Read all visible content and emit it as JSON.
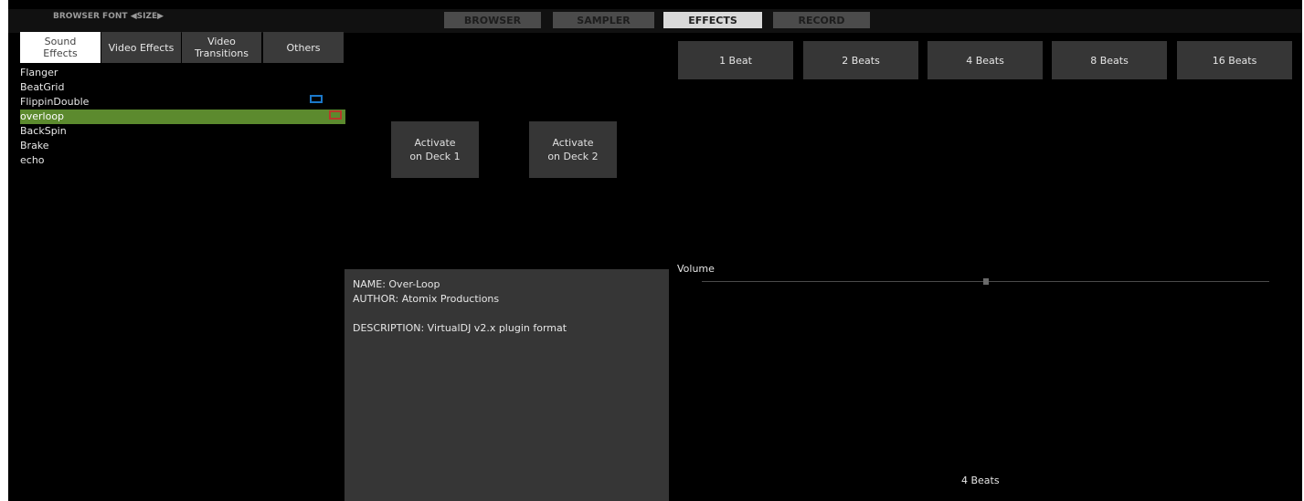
{
  "header": {
    "browser_font": "BROWSER FONT",
    "size": "SIZE",
    "left_arrow": "◀",
    "right_arrow": "▶"
  },
  "main_tabs": [
    {
      "label": "BROWSER",
      "active": false
    },
    {
      "label": "SAMPLER",
      "active": false
    },
    {
      "label": "EFFECTS",
      "active": true
    },
    {
      "label": "RECORD",
      "active": false
    }
  ],
  "sub_tabs": [
    {
      "line1": "Sound",
      "line2": "Effects",
      "active": true
    },
    {
      "line1": "Video Effects",
      "line2": "",
      "active": false
    },
    {
      "line1": "Video",
      "line2": "Transitions",
      "active": false
    },
    {
      "line1": "Others",
      "line2": "",
      "active": false
    }
  ],
  "effects": [
    {
      "label": "Flanger",
      "selected": false
    },
    {
      "label": "BeatGrid",
      "selected": false
    },
    {
      "label": "FlippinDouble",
      "selected": false
    },
    {
      "label": "overloop",
      "selected": true
    },
    {
      "label": "BackSpin",
      "selected": false
    },
    {
      "label": "Brake",
      "selected": false
    },
    {
      "label": "echo",
      "selected": false
    }
  ],
  "activate_buttons": [
    {
      "line1": "Activate",
      "line2": "on Deck 1"
    },
    {
      "line1": "Activate",
      "line2": "on Deck 2"
    }
  ],
  "beat_buttons": [
    "1 Beat",
    "2 Beats",
    "4 Beats",
    "8 Beats",
    "16 Beats"
  ],
  "info": {
    "name": "NAME: Over-Loop",
    "author": "AUTHOR: Atomix Productions",
    "description": "DESCRIPTION: VirtualDJ v2.x plugin format"
  },
  "volume": {
    "label": "Volume",
    "level": 0.5
  },
  "bottom_value": "4 Beats",
  "colors": {
    "background": "#000000",
    "selected_row": "#5c8a2e",
    "button": "#363636",
    "active_tab": "#d9d9d9",
    "marker_blue": "#1b78c9",
    "marker_red": "#b73a2a"
  }
}
